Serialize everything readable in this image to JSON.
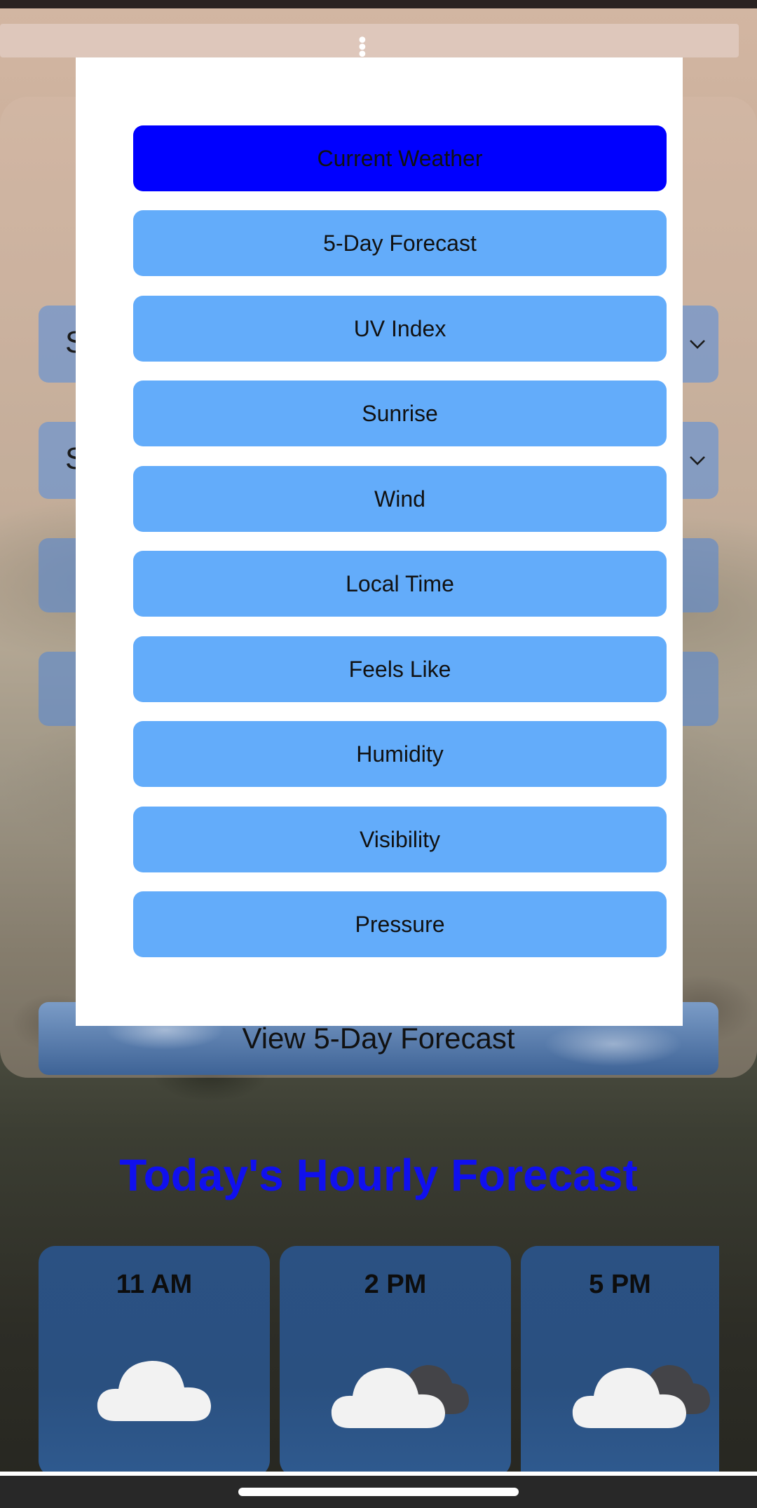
{
  "background_fields": {
    "field1_lead": "S",
    "field2_lead": "S"
  },
  "forecast_button": "View 5-Day Forecast",
  "hourly": {
    "title": "Today's Hourly Forecast",
    "cards": [
      {
        "time": "11 AM",
        "icon": "cloud-icon"
      },
      {
        "time": "2 PM",
        "icon": "partly-cloudy-icon"
      },
      {
        "time": "5 PM",
        "icon": "partly-cloudy-icon"
      }
    ]
  },
  "menu": {
    "items": [
      {
        "label": "Current Weather",
        "active": true
      },
      {
        "label": "5-Day Forecast"
      },
      {
        "label": "UV Index"
      },
      {
        "label": "Sunrise"
      },
      {
        "label": "Wind"
      },
      {
        "label": "Local Time"
      },
      {
        "label": "Feels Like"
      },
      {
        "label": "Humidity"
      },
      {
        "label": "Visibility"
      },
      {
        "label": "Pressure"
      }
    ]
  },
  "colors": {
    "active_item": "#0000ff",
    "menu_item": "#63acfa",
    "hourly_title": "#1010ee"
  }
}
